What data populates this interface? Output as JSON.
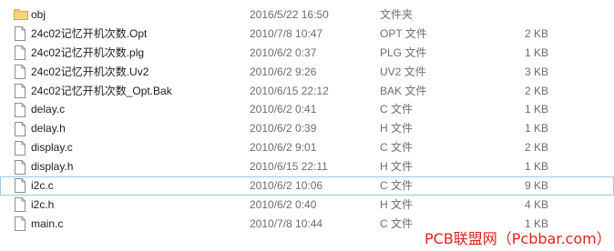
{
  "files": [
    {
      "name": "obj",
      "date": "2016/5/22 16:50",
      "type": "文件夹",
      "size": "",
      "icon": "folder-icon"
    },
    {
      "name": "24c02记忆开机次数.Opt",
      "date": "2010/7/8 10:47",
      "type": "OPT 文件",
      "size": "2 KB",
      "icon": "file-icon"
    },
    {
      "name": "24c02记忆开机次数.plg",
      "date": "2010/6/2 0:37",
      "type": "PLG 文件",
      "size": "1 KB",
      "icon": "file-icon"
    },
    {
      "name": "24c02记忆开机次数.Uv2",
      "date": "2010/6/2 9:26",
      "type": "UV2 文件",
      "size": "3 KB",
      "icon": "file-icon"
    },
    {
      "name": "24c02记忆开机次数_Opt.Bak",
      "date": "2010/6/15 22:12",
      "type": "BAK 文件",
      "size": "2 KB",
      "icon": "file-icon"
    },
    {
      "name": "delay.c",
      "date": "2010/6/2 0:41",
      "type": "C 文件",
      "size": "1 KB",
      "icon": "file-icon"
    },
    {
      "name": "delay.h",
      "date": "2010/6/2 0:39",
      "type": "H 文件",
      "size": "1 KB",
      "icon": "file-icon"
    },
    {
      "name": "display.c",
      "date": "2010/6/2 9:01",
      "type": "C 文件",
      "size": "2 KB",
      "icon": "file-icon"
    },
    {
      "name": "display.h",
      "date": "2010/6/15 22:11",
      "type": "H 文件",
      "size": "1 KB",
      "icon": "file-icon"
    },
    {
      "name": "i2c.c",
      "date": "2010/6/2 10:06",
      "type": "C 文件",
      "size": "9 KB",
      "icon": "file-icon",
      "selected": true
    },
    {
      "name": "i2c.h",
      "date": "2010/6/2 0:40",
      "type": "H 文件",
      "size": "4 KB",
      "icon": "file-icon"
    },
    {
      "name": "main.c",
      "date": "2010/7/8 10:44",
      "type": "C 文件",
      "size": "1 KB",
      "icon": "file-icon"
    }
  ],
  "watermark": "PCB联盟网（Pcbbar.com）",
  "colors": {
    "selection_border": "#99c9ef",
    "folder": "#f0c862",
    "watermark": "#e2231a",
    "secondary_text": "#6d6d6d"
  }
}
